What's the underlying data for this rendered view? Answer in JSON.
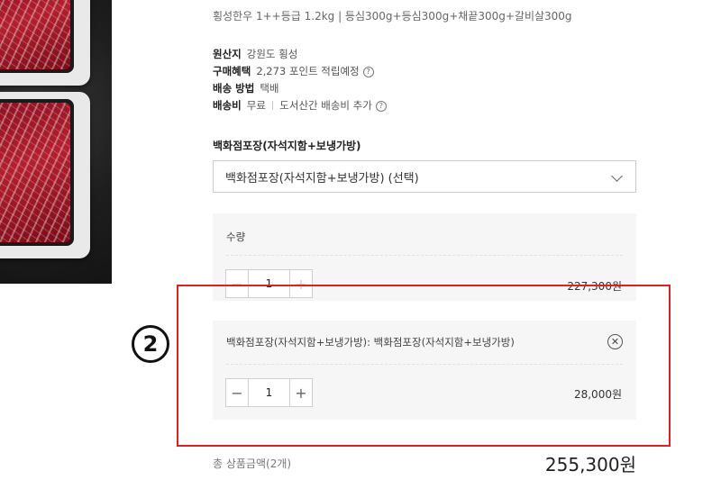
{
  "product": {
    "description": "횡성한우 1++등급 1.2kg | 등심300g+등심300g+채끝300g+갈비살300g"
  },
  "info": [
    {
      "label": "원산지",
      "value": "강원도 횡성"
    },
    {
      "label": "구매혜택",
      "value": "2,273 포인트 적립예정",
      "icon": "help-icon"
    },
    {
      "label": "배송 방법",
      "value": "택배"
    },
    {
      "label": "배송비",
      "value": "무료",
      "extra": "도서산간 배송비 추가",
      "icon": "help-icon"
    }
  ],
  "help_glyph": "?",
  "separator": "|",
  "option": {
    "title": "백화점포장(자석지함+보냉가방)",
    "selected": "백화점포장(자석지함+보냉가방) (선택)"
  },
  "cart": {
    "items": [
      {
        "label": "수량",
        "quantity": "1",
        "price": "227,300원",
        "decrement": "−",
        "increment": "+"
      },
      {
        "label": "백화점포장(자석지함+보냉가방): 백화점포장(자석지함+보냉가방)",
        "quantity": "1",
        "price": "28,000원",
        "decrement": "−",
        "increment": "+",
        "remove": "✕"
      }
    ]
  },
  "marker": "2",
  "total": {
    "label": "총 상품금액(2개)",
    "value": "255,300원"
  },
  "colors": {
    "highlight": "#e02020",
    "card_bg": "#f6f6f6"
  }
}
